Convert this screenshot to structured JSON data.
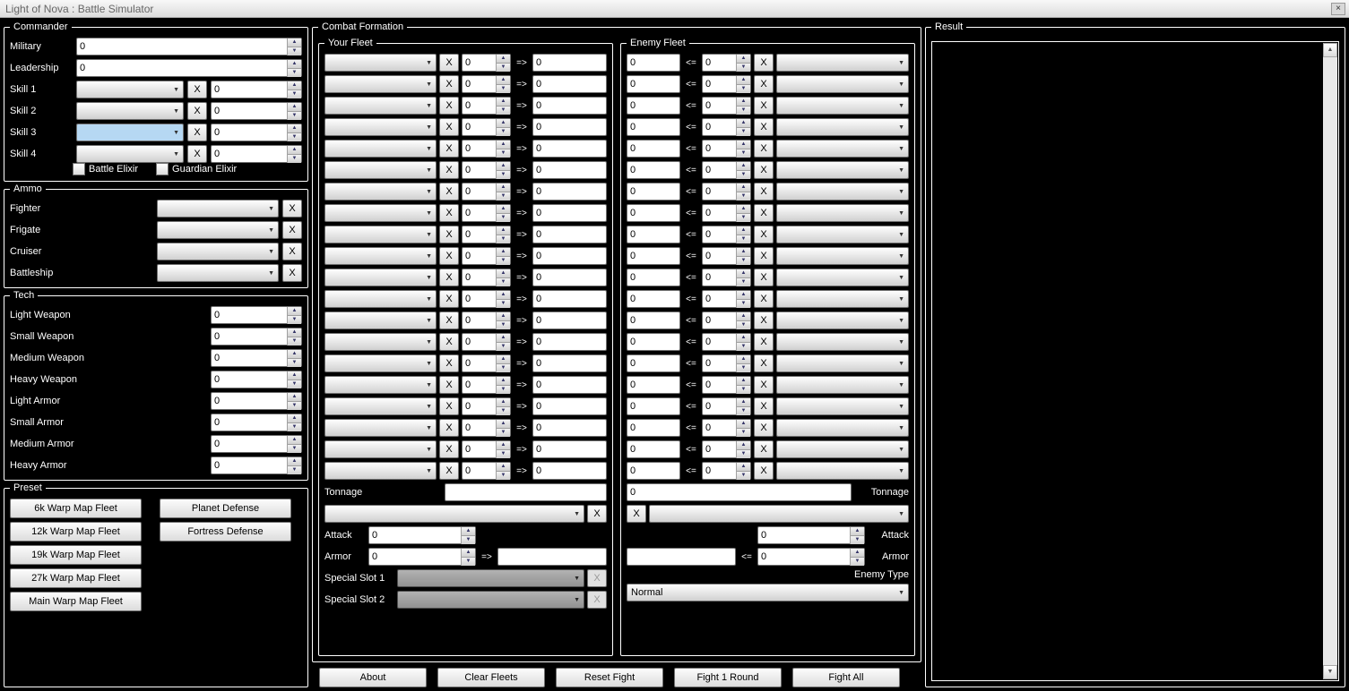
{
  "window": {
    "title": "Light of Nova : Battle Simulator",
    "close": "×"
  },
  "commander": {
    "legend": "Commander",
    "military_label": "Military",
    "military_value": "0",
    "leadership_label": "Leadership",
    "leadership_value": "0",
    "skills": [
      {
        "label": "Skill 1",
        "combo": "",
        "x": "X",
        "value": "0"
      },
      {
        "label": "Skill 2",
        "combo": "",
        "x": "X",
        "value": "0"
      },
      {
        "label": "Skill 3",
        "combo": "",
        "x": "X",
        "value": "0"
      },
      {
        "label": "Skill 4",
        "combo": "",
        "x": "X",
        "value": "0"
      }
    ],
    "battle_elixir_label": "Battle Elixir",
    "guardian_elixir_label": "Guardian Elixir"
  },
  "ammo": {
    "legend": "Ammo",
    "rows": [
      {
        "label": "Fighter",
        "combo": "",
        "x": "X"
      },
      {
        "label": "Frigate",
        "combo": "",
        "x": "X"
      },
      {
        "label": "Cruiser",
        "combo": "",
        "x": "X"
      },
      {
        "label": "Battleship",
        "combo": "",
        "x": "X"
      }
    ]
  },
  "tech": {
    "legend": "Tech",
    "rows": [
      {
        "label": "Light Weapon",
        "value": "0"
      },
      {
        "label": "Small Weapon",
        "value": "0"
      },
      {
        "label": "Medium Weapon",
        "value": "0"
      },
      {
        "label": "Heavy Weapon",
        "value": "0"
      },
      {
        "label": "Light Armor",
        "value": "0"
      },
      {
        "label": "Small Armor",
        "value": "0"
      },
      {
        "label": "Medium Armor",
        "value": "0"
      },
      {
        "label": "Heavy Armor",
        "value": "0"
      }
    ]
  },
  "preset": {
    "legend": "Preset",
    "left": [
      "6k Warp Map Fleet",
      "12k Warp Map Fleet",
      "19k Warp Map Fleet",
      "27k Warp Map Fleet",
      "Main Warp Map Fleet"
    ],
    "right": [
      "Planet Defense",
      "Fortress Defense"
    ]
  },
  "combat": {
    "legend": "Combat Formation",
    "your_fleet_legend": "Your Fleet",
    "enemy_fleet_legend": "Enemy Fleet",
    "x": "X",
    "arrow_right": "=>",
    "arrow_left": "<=",
    "row_count": 20,
    "your_rows": [
      {
        "combo": "",
        "spin": "0",
        "txt": "0"
      },
      {
        "combo": "",
        "spin": "0",
        "txt": "0"
      },
      {
        "combo": "",
        "spin": "0",
        "txt": "0"
      },
      {
        "combo": "",
        "spin": "0",
        "txt": "0"
      },
      {
        "combo": "",
        "spin": "0",
        "txt": "0"
      },
      {
        "combo": "",
        "spin": "0",
        "txt": "0"
      },
      {
        "combo": "",
        "spin": "0",
        "txt": "0"
      },
      {
        "combo": "",
        "spin": "0",
        "txt": "0"
      },
      {
        "combo": "",
        "spin": "0",
        "txt": "0"
      },
      {
        "combo": "",
        "spin": "0",
        "txt": "0"
      },
      {
        "combo": "",
        "spin": "0",
        "txt": "0"
      },
      {
        "combo": "",
        "spin": "0",
        "txt": "0"
      },
      {
        "combo": "",
        "spin": "0",
        "txt": "0"
      },
      {
        "combo": "",
        "spin": "0",
        "txt": "0"
      },
      {
        "combo": "",
        "spin": "0",
        "txt": "0"
      },
      {
        "combo": "",
        "spin": "0",
        "txt": "0"
      },
      {
        "combo": "",
        "spin": "0",
        "txt": "0"
      },
      {
        "combo": "",
        "spin": "0",
        "txt": "0"
      },
      {
        "combo": "",
        "spin": "0",
        "txt": "0"
      },
      {
        "combo": "",
        "spin": "0",
        "txt": "0"
      }
    ],
    "enemy_rows": [
      {
        "txt": "0",
        "spin": "0",
        "combo": ""
      },
      {
        "txt": "0",
        "spin": "0",
        "combo": ""
      },
      {
        "txt": "0",
        "spin": "0",
        "combo": ""
      },
      {
        "txt": "0",
        "spin": "0",
        "combo": ""
      },
      {
        "txt": "0",
        "spin": "0",
        "combo": ""
      },
      {
        "txt": "0",
        "spin": "0",
        "combo": ""
      },
      {
        "txt": "0",
        "spin": "0",
        "combo": ""
      },
      {
        "txt": "0",
        "spin": "0",
        "combo": ""
      },
      {
        "txt": "0",
        "spin": "0",
        "combo": ""
      },
      {
        "txt": "0",
        "spin": "0",
        "combo": ""
      },
      {
        "txt": "0",
        "spin": "0",
        "combo": ""
      },
      {
        "txt": "0",
        "spin": "0",
        "combo": ""
      },
      {
        "txt": "0",
        "spin": "0",
        "combo": ""
      },
      {
        "txt": "0",
        "spin": "0",
        "combo": ""
      },
      {
        "txt": "0",
        "spin": "0",
        "combo": ""
      },
      {
        "txt": "0",
        "spin": "0",
        "combo": ""
      },
      {
        "txt": "0",
        "spin": "0",
        "combo": ""
      },
      {
        "txt": "0",
        "spin": "0",
        "combo": ""
      },
      {
        "txt": "0",
        "spin": "0",
        "combo": ""
      },
      {
        "txt": "0",
        "spin": "0",
        "combo": ""
      }
    ],
    "tonnage_label": "Tonnage",
    "your_tonnage": "",
    "enemy_tonnage": "0",
    "your_extra_combo": "",
    "enemy_extra_combo": "",
    "attack_label": "Attack",
    "your_attack": "0",
    "enemy_attack": "0",
    "armor_label": "Armor",
    "your_armor": "0",
    "enemy_armor": "",
    "your_armor_result": "",
    "special_slot1_label": "Special Slot 1",
    "special_slot2_label": "Special Slot 2",
    "enemy_type_label": "Enemy Type",
    "enemy_type_value": "Normal"
  },
  "bottom_buttons": [
    "About",
    "Clear Fleets",
    "Reset Fight",
    "Fight 1 Round",
    "Fight All"
  ],
  "result": {
    "legend": "Result"
  }
}
